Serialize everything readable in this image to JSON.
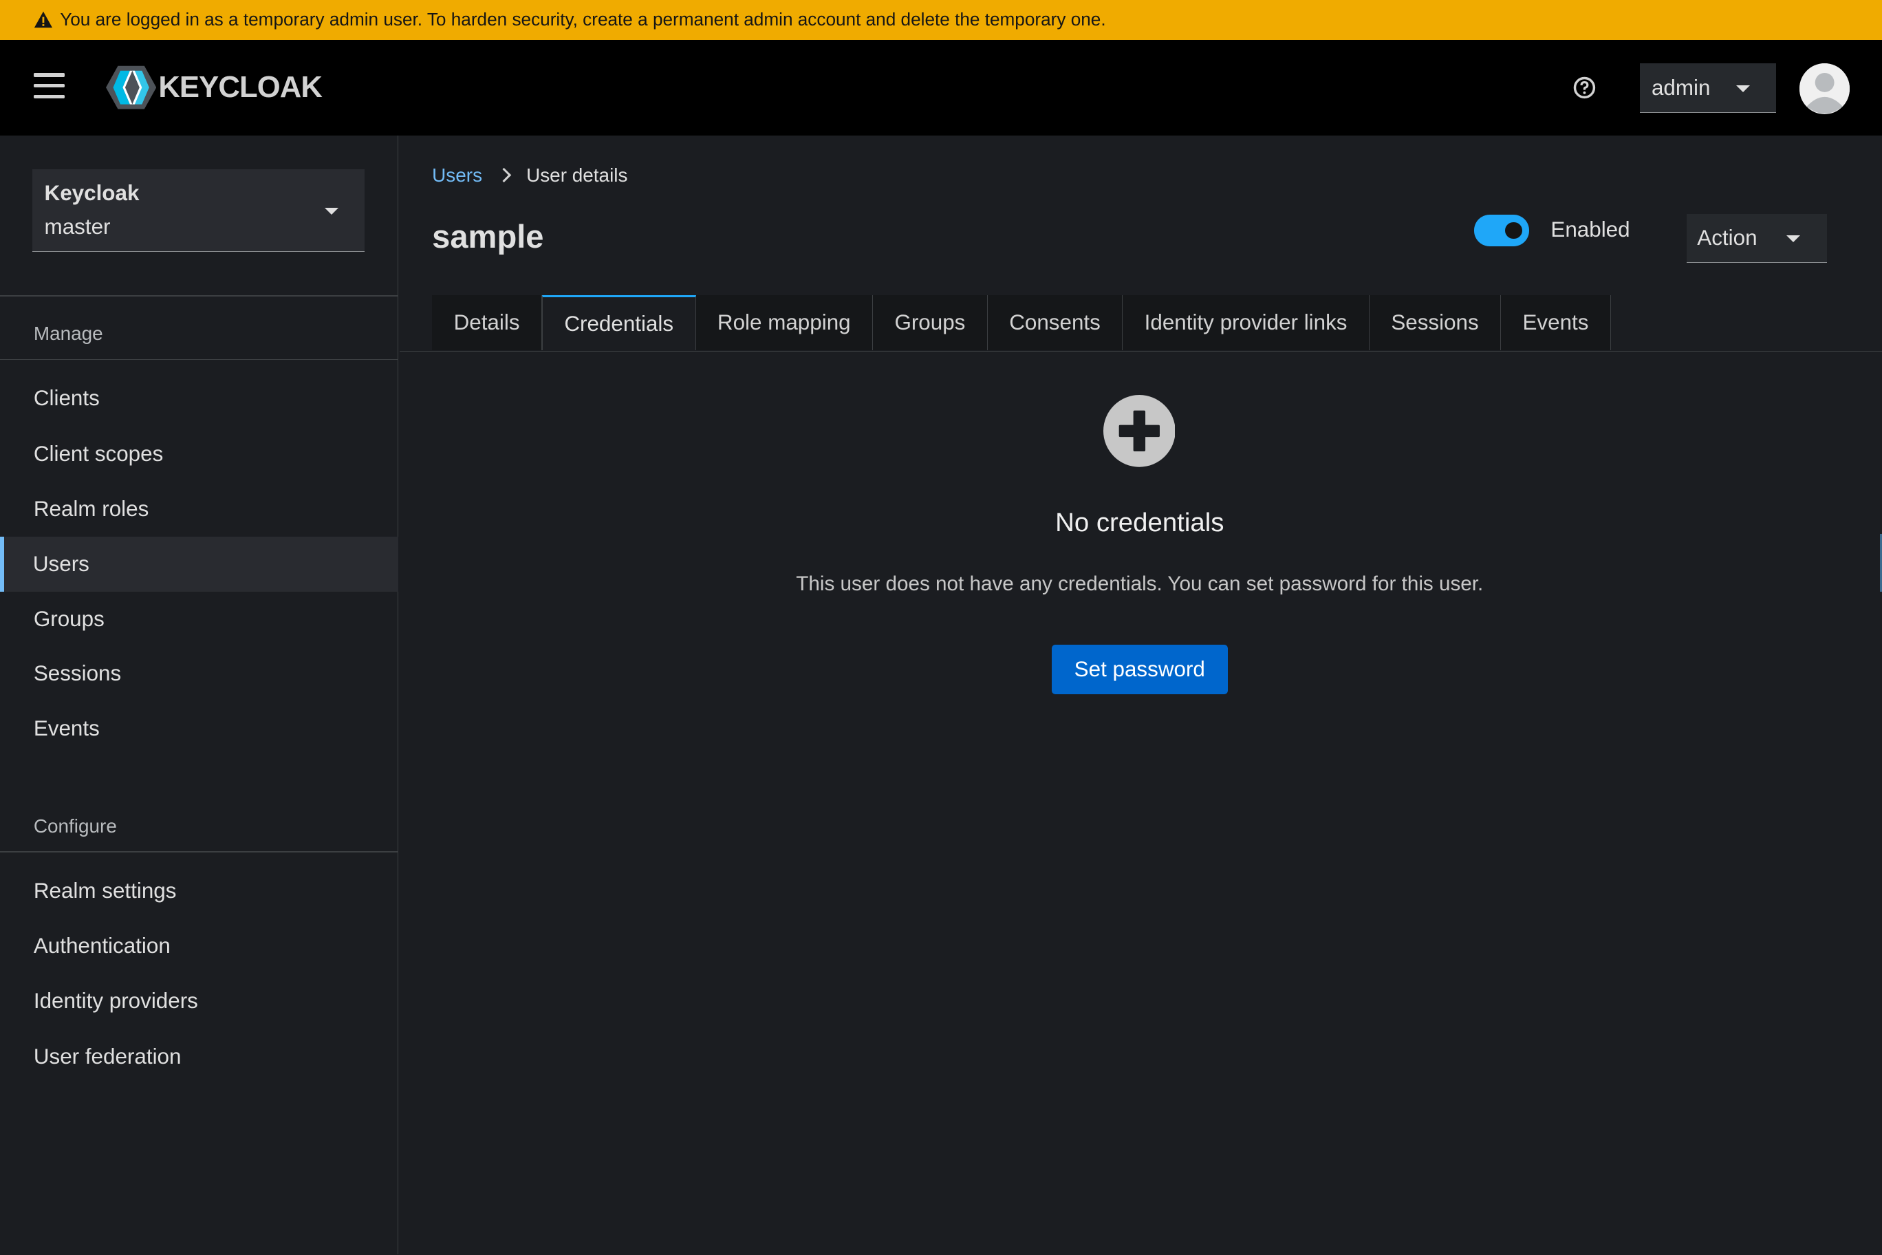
{
  "banner": {
    "text": "You are logged in as a temporary admin user. To harden security, create a permanent admin account and delete the temporary one.",
    "icon": "warning-triangle-icon"
  },
  "header": {
    "logo_text": "KEYCLOAK",
    "user_label": "admin"
  },
  "sidebar": {
    "realm": {
      "product": "Keycloak",
      "name": "master"
    },
    "manage_title": "Manage",
    "manage_items": [
      {
        "label": "Clients"
      },
      {
        "label": "Client scopes"
      },
      {
        "label": "Realm roles"
      },
      {
        "label": "Users",
        "active": true
      },
      {
        "label": "Groups"
      },
      {
        "label": "Sessions"
      },
      {
        "label": "Events"
      }
    ],
    "configure_title": "Configure",
    "configure_items": [
      {
        "label": "Realm settings"
      },
      {
        "label": "Authentication"
      },
      {
        "label": "Identity providers"
      },
      {
        "label": "User federation"
      }
    ]
  },
  "breadcrumb": {
    "parent": "Users",
    "current": "User details"
  },
  "page": {
    "title": "sample",
    "enabled_label": "Enabled",
    "enabled": true,
    "action_label": "Action"
  },
  "tabs": [
    {
      "label": "Details"
    },
    {
      "label": "Credentials",
      "active": true
    },
    {
      "label": "Role mapping"
    },
    {
      "label": "Groups"
    },
    {
      "label": "Consents"
    },
    {
      "label": "Identity provider links"
    },
    {
      "label": "Sessions"
    },
    {
      "label": "Events"
    }
  ],
  "empty_state": {
    "icon": "plus-circle-icon",
    "title": "No credentials",
    "body": "This user does not have any credentials. You can set password for this user.",
    "button": "Set password"
  },
  "colors": {
    "banner": "#f0ab00",
    "accent": "#1fa7f8",
    "primary_button": "#0066cc",
    "link": "#73bcf7"
  }
}
